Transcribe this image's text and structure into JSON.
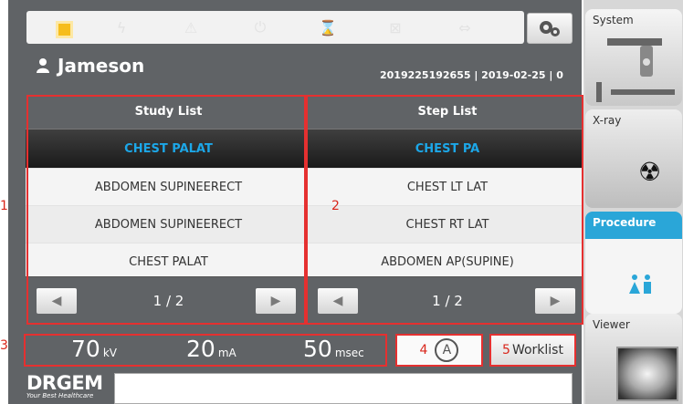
{
  "user": {
    "name": "Jameson",
    "study_info": "2019225192655 | 2019-02-25 | 0"
  },
  "study_list": {
    "header": "Study List",
    "items": [
      "CHEST PALAT",
      "ABDOMEN SUPINEERECT",
      "ABDOMEN SUPINEERECT",
      "CHEST PALAT"
    ],
    "page": "1 / 2"
  },
  "step_list": {
    "header": "Step List",
    "items": [
      "CHEST PA",
      "CHEST LT LAT",
      "CHEST RT LAT",
      "ABDOMEN AP(SUPINE)"
    ],
    "page": "1 / 2"
  },
  "exposure": {
    "kv": {
      "value": "70",
      "unit": "kV"
    },
    "ma": {
      "value": "20",
      "unit": "mA"
    },
    "msec": {
      "value": "50",
      "unit": "msec"
    }
  },
  "buttons": {
    "auto": "A",
    "worklist": "Worklist"
  },
  "annotations": {
    "a1": "1",
    "a2": "2",
    "a3": "3",
    "a4": "4",
    "a5": "5"
  },
  "brand": {
    "name": "DRGEM",
    "tagline": "Your Best Healthcare"
  },
  "side_tabs": {
    "system": "System",
    "xray": "X-ray",
    "procedure": "Procedure",
    "viewer": "Viewer"
  },
  "colors": {
    "accent": "#1ca7e8",
    "annotation": "#e53030",
    "status_indicator": "#f6bd1c"
  }
}
